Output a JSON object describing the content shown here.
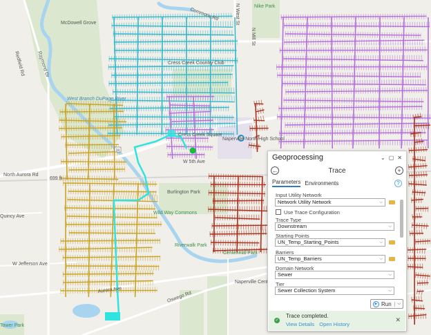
{
  "map": {
    "labels": {
      "nike_park": "Nike Park",
      "mcdowell_grove": "McDowell Grove",
      "cress_creek_cc": "Cress Creek Country Club",
      "west_branch_river": "West Branch DuPage River",
      "cress_creek_square": "Cress Creek Square",
      "naperville_north": "Naperville North High School",
      "burlington_park": "Burlington Park",
      "wild_way_commons": "Wild Way Commons",
      "riverwalk_park": "Riverwalk Park",
      "centennial_park": "Centennial Park",
      "naperville_central": "Naperville Central High School",
      "commons_rd": "Commons Rd",
      "n_west_st": "N West St",
      "n_mill_st": "N Mill St",
      "raymond_dr": "Raymond Dr",
      "redfield_rd": "Redfield Rd",
      "north_aurora_rd": "North Aurora Rd",
      "quincy_ave": "Quincy Ave",
      "w_jefferson_ave": "W Jefferson Ave",
      "aurora_ave": "Aurora Ave",
      "oswego_rd": "Oswego Rd",
      "w_5th_ave": "W 5th Ave",
      "elevation": "699 ft",
      "route_shield": "34",
      "tower_park": "Tower Park"
    },
    "network_colors": {
      "trace_result": "#2fe3e0",
      "north_network": "#36b6c9",
      "purple_network": "#b36fd8",
      "gold_network": "#c9a227",
      "red_network": "#a8321e",
      "starting_point": "#1fbf2a"
    }
  },
  "geoprocessing": {
    "title": "Geoprocessing",
    "tool_title": "Trace",
    "tabs": [
      "Parameters",
      "Environments"
    ],
    "params": {
      "input_utility_network_label": "Input Utility Network",
      "input_utility_network_value": "Network Utility Network",
      "use_trace_config_label": "Use Trace Configuration",
      "use_trace_config_checked": false,
      "trace_type_label": "Trace Type",
      "trace_type_value": "Downstream",
      "starting_points_label": "Starting Points",
      "starting_points_value": "UN_Temp_Starting_Points",
      "barriers_label": "Barriers",
      "barriers_value": "UN_Temp_Barriers",
      "domain_network_label": "Domain Network",
      "domain_network_value": "Sewer",
      "tier_label": "Tier",
      "tier_value": "Sewer Collection System"
    },
    "run_label": "Run",
    "status": {
      "message": "Trace completed.",
      "view_details": "View Details",
      "open_history": "Open History"
    }
  }
}
